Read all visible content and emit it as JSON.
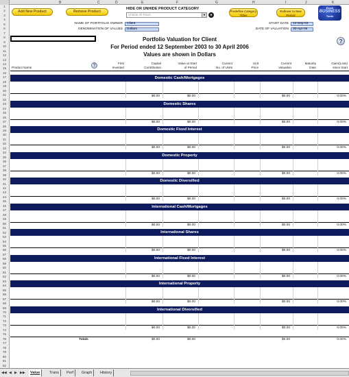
{
  "columns": [
    "B",
    "C",
    "D",
    "E",
    "F",
    "G",
    "H",
    "I",
    "J",
    "K"
  ],
  "rows": [
    "1",
    "2",
    "3",
    "4",
    "5",
    "6",
    "7",
    "8",
    "9",
    "10",
    "11",
    "12",
    "13",
    "14",
    "15",
    "16",
    "17",
    "18",
    "19",
    "20",
    "21",
    "22",
    "23",
    "24",
    "25",
    "26",
    "27",
    "28",
    "29",
    "30",
    "31",
    "32",
    "33",
    "34",
    "35",
    "36",
    "37",
    "38",
    "39",
    "40",
    "41",
    "42",
    "43",
    "44",
    "45",
    "46",
    "47",
    "48",
    "49",
    "50",
    "51",
    "52",
    "53",
    "54",
    "55",
    "56",
    "57",
    "58",
    "59",
    "60",
    "61",
    "62",
    "63",
    "64",
    "65",
    "66",
    "67",
    "68",
    "69",
    "70",
    "71",
    "72",
    "73",
    "74",
    "75",
    "76",
    "77",
    "78",
    "79",
    "80",
    "81",
    "82"
  ],
  "buttons": {
    "add_product": "Add New Product",
    "remove_product": "Remove Product",
    "predefine": "Predefine Category Titles",
    "rollover": "Rollover to New Period"
  },
  "category": {
    "label": "HIDE OR UNHIDE PRODUCT CATEGORY",
    "placeholder": "Unhide All Rows",
    "arrow": "▼",
    "go": "●"
  },
  "logo": {
    "line1": "Excel",
    "line2": "BUSINESS",
    "line3": "Tools"
  },
  "owner": {
    "label": "NAME OF PORTFOLIO OWNER",
    "value": "Client"
  },
  "denomination": {
    "label": "DENOMINATION OF VALUES",
    "value": "Dollars"
  },
  "start_date": {
    "label": "START DATE",
    "value": "12-Sep-03"
  },
  "valuation_date": {
    "label": "DATE OF VALUATION",
    "value": "30-Apr-06"
  },
  "report": {
    "title": "Portfolio Valuation for Client",
    "period": "For Period ended 12 September 2003 to 30 April 2006",
    "currency": "Values are shown in Dollars",
    "help": "?"
  },
  "headers": {
    "product_name": "Product Name",
    "help": "?",
    "first_invested": [
      "First",
      "Invested"
    ],
    "capital_contribution": [
      "Capital",
      "Contribution"
    ],
    "value_start": [
      "Value at Start",
      "of Period"
    ],
    "current_units": [
      "Current",
      "No. of Units"
    ],
    "unit_price": [
      "Unit",
      "Price"
    ],
    "current_valuation": [
      "Current",
      "Valuation"
    ],
    "maturity_date": [
      "Maturity",
      "Date"
    ],
    "gain_loss": [
      "Gain/(Loss)",
      "since Start"
    ]
  },
  "sections": [
    {
      "title": "Domestic Cash/Mortgages",
      "capital": "$0.00",
      "start": "$0.00",
      "valuation": "$0.00",
      "gain": "0.00%"
    },
    {
      "title": "Domestic Shares",
      "capital": "$0.00",
      "start": "$0.00",
      "valuation": "$0.00",
      "gain": "0.00%"
    },
    {
      "title": "Domestic Fixed Interest",
      "capital": "$0.00",
      "start": "$0.00",
      "valuation": "$0.00",
      "gain": "0.00%"
    },
    {
      "title": "Domestic Property",
      "capital": "$0.00",
      "start": "$0.00",
      "valuation": "$0.00",
      "gain": "0.00%"
    },
    {
      "title": "Domestic Diversified",
      "capital": "$0.00",
      "start": "$0.00",
      "valuation": "$0.00",
      "gain": "0.00%"
    },
    {
      "title": "International Cash/Mortgages",
      "capital": "$0.00",
      "start": "$0.00",
      "valuation": "$0.00",
      "gain": "0.00%"
    },
    {
      "title": "International Shares",
      "capital": "$0.00",
      "start": "$0.00",
      "valuation": "$0.00",
      "gain": "0.00%"
    },
    {
      "title": "International Fixed Interest",
      "capital": "$0.00",
      "start": "$0.00",
      "valuation": "$0.00",
      "gain": "0.00%"
    },
    {
      "title": "International Property",
      "capital": "$0.00",
      "start": "$0.00",
      "valuation": "$0.00",
      "gain": "0.00%"
    },
    {
      "title": "International Diversified",
      "capital": "$0.00",
      "start": "$0.00",
      "valuation": "$0.00",
      "gain": "0.00%"
    }
  ],
  "totals": {
    "label": "Totals",
    "capital": "$0.00",
    "start": "$0.00",
    "valuation": "$0.00",
    "gain": "0.00%"
  },
  "sheet_tabs": [
    "Value",
    "Trans",
    "Perf",
    "Graph",
    "History"
  ],
  "active_tab": "Value",
  "nav": [
    "◀◀",
    "◀",
    "▶",
    "▶▶"
  ]
}
